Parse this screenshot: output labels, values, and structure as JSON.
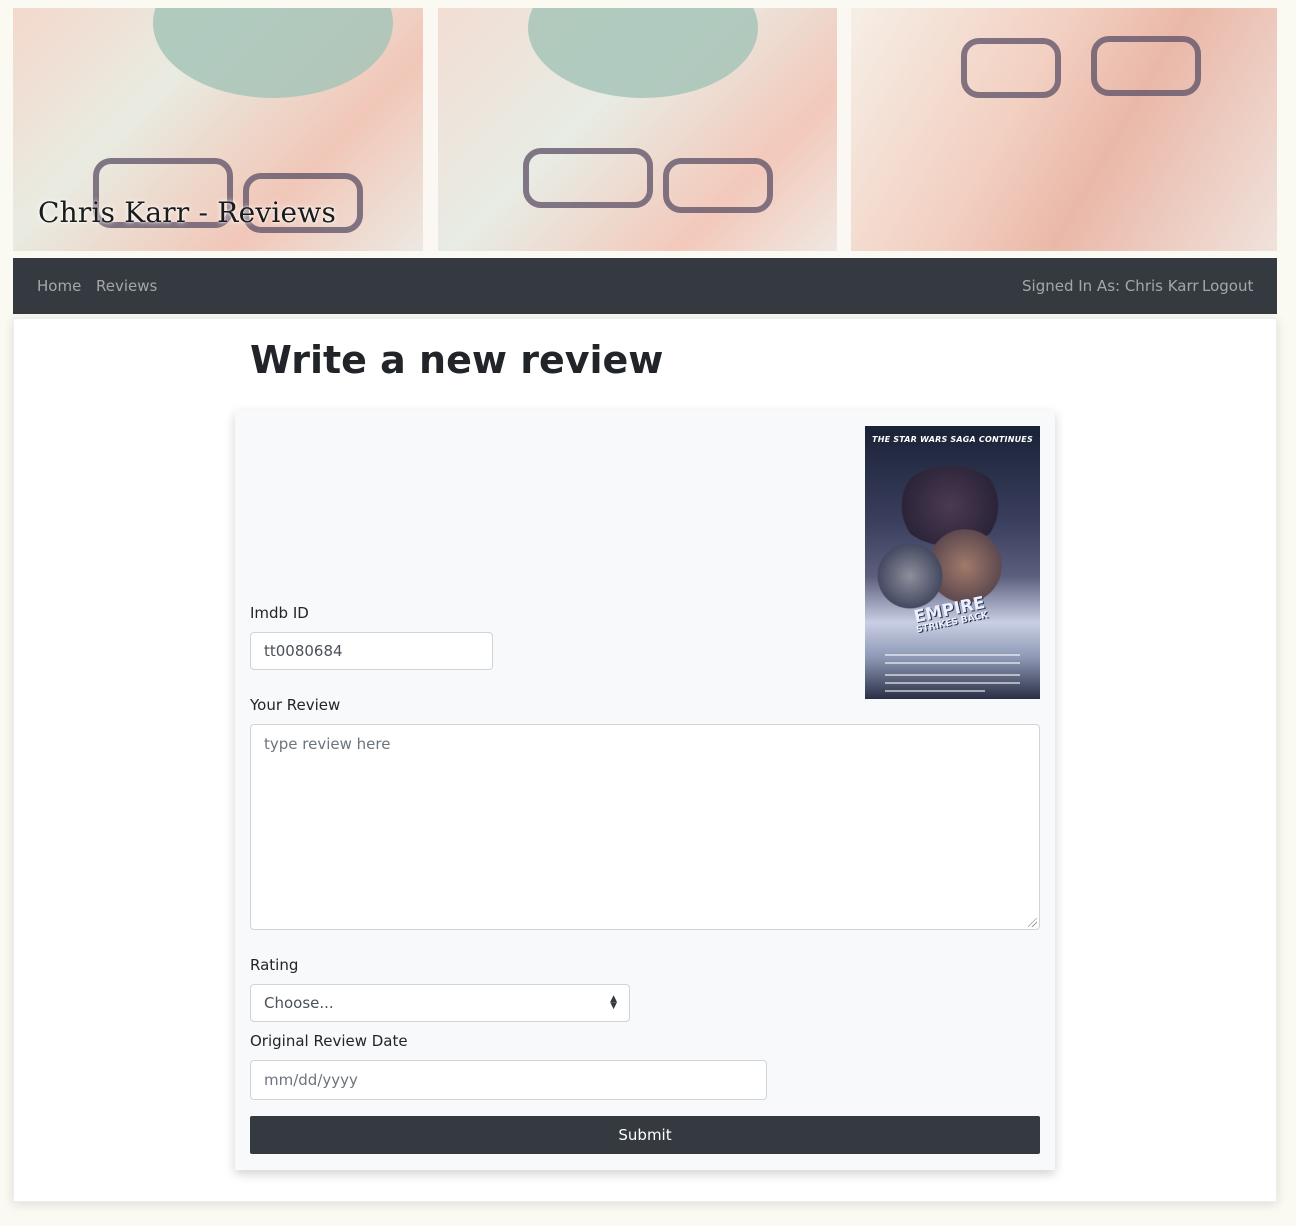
{
  "header": {
    "site_title": "Chris Karr - Reviews"
  },
  "nav": {
    "home": "Home",
    "reviews": "Reviews",
    "signed_in": "Signed In As: Chris Karr",
    "logout": "Logout"
  },
  "page": {
    "title": "Write a new review"
  },
  "poster": {
    "tagline": "THE STAR WARS SAGA CONTINUES",
    "logo_main": "EMPIRE",
    "logo_sub": "STRIKES BACK"
  },
  "form": {
    "imdb_label": "Imdb ID",
    "imdb_value": "tt0080684",
    "review_label": "Your Review",
    "review_placeholder": "type review here",
    "rating_label": "Rating",
    "rating_selected": "Choose...",
    "date_label": "Original Review Date",
    "date_placeholder": "mm/dd/yyyy",
    "submit_label": "Submit"
  },
  "colors": {
    "navbar": "#343a40",
    "page_bg": "#fafaf2",
    "form_bg": "#f8f9fa",
    "button": "#343a40"
  }
}
